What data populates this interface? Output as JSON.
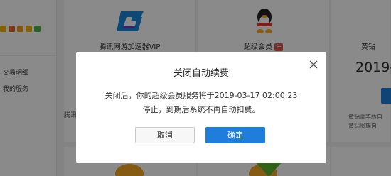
{
  "sidebar": {
    "items": [
      {
        "label": "交易明细"
      },
      {
        "label": "我的服务"
      }
    ]
  },
  "cards": [
    {
      "name": "腾讯网游加速器VIP",
      "stub_text": "腾讯"
    },
    {
      "name": "超级会员",
      "tag": "年"
    },
    {
      "name": "黄钻",
      "price": "2019-",
      "desc1": "黄钻豪华版自",
      "desc2": "黄钻贵族自"
    }
  ],
  "dialog": {
    "title": "关闭自动续费",
    "line1": "关闭后，你的超级会员服务将于2019-03-17 02:00:23",
    "line2": "停止，到期后系统不再自动扣费。",
    "cancel_label": "取消",
    "confirm_label": "确定",
    "close_icon": "close-icon"
  },
  "colors": {
    "primary": "#1f7edb",
    "overlay": "rgba(0,0,0,0.46)",
    "annual_tag": "#e5544a"
  }
}
